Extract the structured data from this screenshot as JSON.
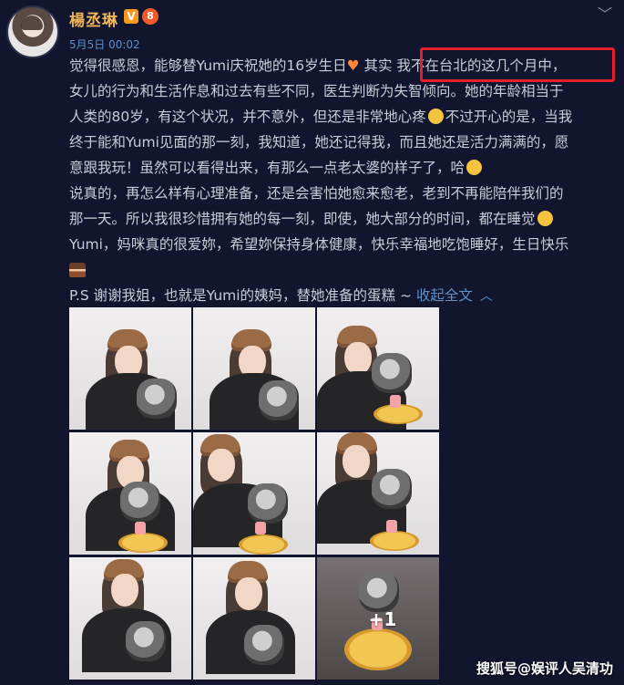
{
  "header": {
    "username": "楊丞琳",
    "verified_badge": "V",
    "level_badge": "8",
    "timestamp": "5月5日 00:02",
    "chevron": "﹀"
  },
  "post": {
    "line1": "觉得很感恩，能够替Yumi庆祝她的16岁生日",
    "line1_after_heart": " 其实 ",
    "line1_highlight": "我不在台北的这几个月中，",
    "line2": "女儿的行为和生活作息和过去有些不同，医生判断为失智倾向。她的年龄相当于",
    "line3": "人类的80岁，有这个状况，并不意外，但还是非常地心疼",
    "line3_after": "不过开心的是，当我",
    "line4": "终于能和Yumi见面的那一刻，我知道，她还记得我，而且她还是活力满满的，愿",
    "line5": "意跟我玩！虽然可以看得出来，有那么一点老太婆的样子了，哈",
    "line6": "说真的，再怎么样有心理准备，还是会害怕她愈来愈老，老到不再能陪伴我们的",
    "line7": "那一天。所以我很珍惜拥有她的每一刻，即使，她大部分的时间，都在睡觉",
    "line8": "Yumi，妈咪真的很爱妳，希望妳保持身体健康，快乐幸福地吃饱睡好，生日快乐",
    "ps_text": "P.S 谢谢我姐，也就是Yumi的姨妈，替她准备的蛋糕 ~ ",
    "collapse_link": "收起全文",
    "collapse_caret": "︿"
  },
  "gallery": {
    "more_count": "+1"
  },
  "watermark": "搜狐号@娱评人吴清功",
  "colors": {
    "background": "#11162e",
    "username": "#f0b45a",
    "link": "#5f8fc6",
    "highlight_box": "#e3202a"
  }
}
